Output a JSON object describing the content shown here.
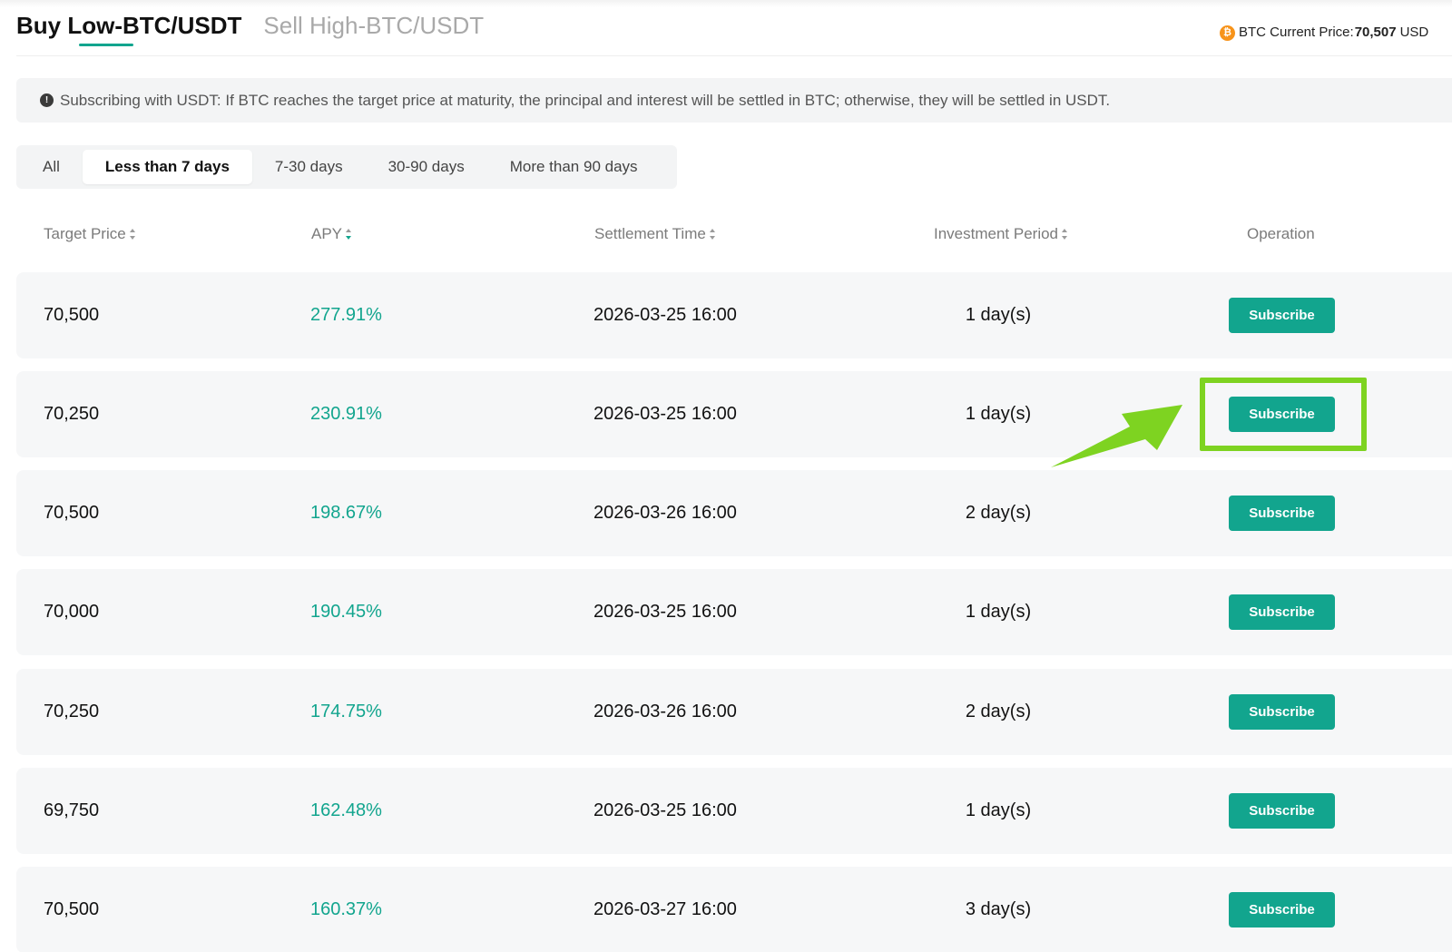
{
  "header": {
    "tabs": [
      {
        "label": "Buy Low-BTC/USDT",
        "active": true
      },
      {
        "label": "Sell High-BTC/USDT",
        "active": false
      }
    ],
    "price_label": "BTC Current Price:",
    "price_value": "70,507",
    "price_unit": "USD",
    "btc_icon_glyph": "₿",
    "accent_color": "#12a58e"
  },
  "notice": {
    "icon_glyph": "!",
    "text": "Subscribing with USDT: If BTC reaches the target price at maturity, the principal and interest will be settled in BTC; otherwise, they will be settled in USDT."
  },
  "filters": [
    {
      "label": "All",
      "active": false
    },
    {
      "label": "Less than 7 days",
      "active": true
    },
    {
      "label": "7-30 days",
      "active": false
    },
    {
      "label": "30-90 days",
      "active": false
    },
    {
      "label": "More than 90 days",
      "active": false
    }
  ],
  "table": {
    "columns": {
      "target_price": "Target Price",
      "apy": "APY",
      "settlement_time": "Settlement Time",
      "investment_period": "Investment Period",
      "operation": "Operation"
    },
    "button_label": "Subscribe",
    "rows": [
      {
        "target_price": "70,500",
        "apy": "277.91%",
        "settlement_time": "2026-03-25 16:00",
        "investment_period": "1 day(s)"
      },
      {
        "target_price": "70,250",
        "apy": "230.91%",
        "settlement_time": "2026-03-25 16:00",
        "investment_period": "1 day(s)"
      },
      {
        "target_price": "70,500",
        "apy": "198.67%",
        "settlement_time": "2026-03-26 16:00",
        "investment_period": "2 day(s)"
      },
      {
        "target_price": "70,000",
        "apy": "190.45%",
        "settlement_time": "2026-03-25 16:00",
        "investment_period": "1 day(s)"
      },
      {
        "target_price": "70,250",
        "apy": "174.75%",
        "settlement_time": "2026-03-26 16:00",
        "investment_period": "2 day(s)"
      },
      {
        "target_price": "69,750",
        "apy": "162.48%",
        "settlement_time": "2026-03-25 16:00",
        "investment_period": "1 day(s)"
      },
      {
        "target_price": "70,500",
        "apy": "160.37%",
        "settlement_time": "2026-03-27 16:00",
        "investment_period": "3 day(s)"
      }
    ]
  },
  "annotation": {
    "highlight_color": "#7ed321",
    "highlighted_row": 1
  }
}
